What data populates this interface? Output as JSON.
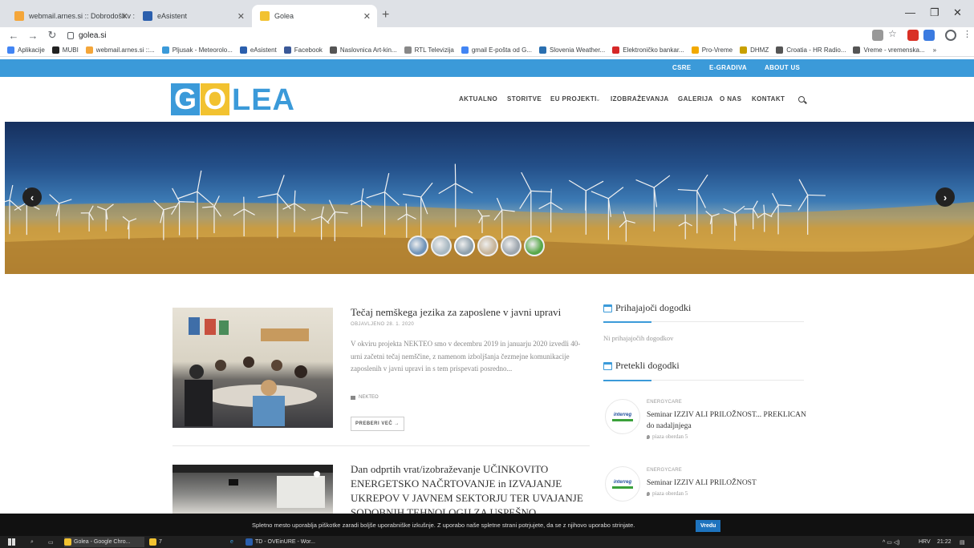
{
  "browser": {
    "tabs": [
      {
        "label": "webmail.arnes.si :: Dobrodošli v ::",
        "favicon_color": "#f4a63a",
        "active": false
      },
      {
        "label": "eAsistent",
        "favicon_color": "#2b5fad",
        "active": false
      },
      {
        "label": "Golea",
        "favicon_color": "#f2c230",
        "active": true
      }
    ],
    "new_tab": "+",
    "url": "golea.si",
    "bookmarks": [
      {
        "label": "Aplikacije",
        "color": "#4285f4"
      },
      {
        "label": "MUBI",
        "color": "#222222"
      },
      {
        "label": "webmail.arnes.si ::...",
        "color": "#f4a63a"
      },
      {
        "label": "Pljusak - Meteorolo...",
        "color": "#3b9ad9"
      },
      {
        "label": "eAsistent",
        "color": "#2b5fad"
      },
      {
        "label": "Facebook",
        "color": "#3b5998"
      },
      {
        "label": "Naslovnica Art-kin...",
        "color": "#555555"
      },
      {
        "label": "RTL Televizija",
        "color": "#888888"
      },
      {
        "label": "gmail E-pošta od G...",
        "color": "#4285f4"
      },
      {
        "label": "Slovenia Weather...",
        "color": "#2a6fb0"
      },
      {
        "label": "Elektroničko bankar...",
        "color": "#d62828"
      },
      {
        "label": "Pro-Vreme",
        "color": "#f2a900"
      },
      {
        "label": "DHMZ",
        "color": "#c8a000"
      },
      {
        "label": "Croatia - HR Radio...",
        "color": "#555555"
      },
      {
        "label": "Vreme - vremenska...",
        "color": "#555555"
      }
    ],
    "bookmarks_more": "»"
  },
  "site": {
    "top_links": [
      "CSRE",
      "E-GRADIVA",
      "ABOUT US"
    ],
    "logo": {
      "letters": [
        "G",
        "O"
      ],
      "rest": "LEA",
      "colors": [
        "#3b9ad9",
        "#f2c230"
      ]
    },
    "nav": [
      "AKTUALNO",
      "STORITVE",
      "EU PROJEKTI",
      "IZOBRAŽEVANJA",
      "GALERIJA",
      "O NAS",
      "KONTAKT"
    ],
    "nav_dropdown_marker": "⌄",
    "slider": {
      "prev": "‹",
      "next": "›",
      "thumb_count": 6,
      "active_thumb": 2
    }
  },
  "posts": [
    {
      "title": "Tečaj nemškega jezika za zaposlene v javni upravi",
      "date": "OBJAVLJENO 28. 1. 2020",
      "excerpt": "V okviru projekta NEKTEO smo v decembru 2019 in januarju 2020 izvedli 40-urni začetni tečaj nemščine, z namenom izboljšanja čezmejne komunikacije zaposlenih v javni upravi in s tem prispevati posredno...",
      "category": "NEKTEO",
      "read_more": "PREBERI VEČ →"
    },
    {
      "title": "Dan odprtih vrat/izobraževanje UČINKOVITO ENERGETSKO NAČRTOVANJE in IZVAJANJE UKREPOV V JAVNEM SEKTORJU TER UVAJANJE SODOBNIH TEHNOLOGIJ ZA USPEŠNO PRILAGAJANJE"
    }
  ],
  "sidebar": {
    "upcoming_title": "Prihajajoči dogodki",
    "upcoming_empty": "Ni prihajajočih dogodkov",
    "past_title": "Pretekli dogodki",
    "events": [
      {
        "category": "ENERGYCARE",
        "title": "Seminar IZZIV ALI PRILOŽNOST... PREKLICAN do nadaljnjega",
        "location": "piaza oberdan 5",
        "logo": "interreg"
      },
      {
        "category": "ENERGYCARE",
        "title": "Seminar IZZIV ALI PRILOŽNOST",
        "location": "piaza oberdan 5",
        "logo": "interreg"
      }
    ]
  },
  "cookie_bar": {
    "text": "Spletno mesto uporablja piškotke zaradi boljše uporabniške izkušnje. Z uporabo naše spletne strani potrjujete, da se z njihovo uporabo strinjate.",
    "button": "Vredu"
  },
  "taskbar": {
    "items": [
      {
        "label": "Golea - Google Chro...",
        "color": "#f2c230"
      },
      {
        "label": "7",
        "color": "#f2c230"
      },
      {
        "label": "TD - OVEinURE - Wor...",
        "color": "#2b5fad"
      }
    ],
    "language": "HRV",
    "time": "21:22"
  }
}
